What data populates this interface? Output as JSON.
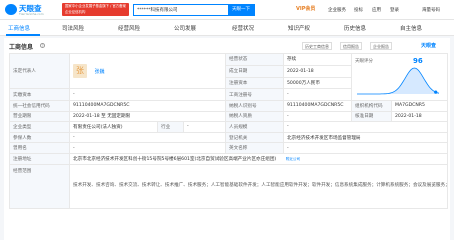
{
  "header": {
    "logo_text": "天眼查",
    "logo_subtext": "TianYanCha.com",
    "promo_text": "国家中小企业发展子基金旗下 / 官方备案企业征信机构",
    "search_value": "******科技有限公司",
    "search_button": "天眼一下",
    "vip_label": "VIP会员",
    "nav": [
      "企业服务",
      "投标",
      "应用",
      "登录"
    ],
    "phone_label": "海量号码"
  },
  "tabs": [
    {
      "label": "工商信息",
      "count": ""
    },
    {
      "label": "司法风险",
      "count": ""
    },
    {
      "label": "经营风险",
      "count": ""
    },
    {
      "label": "公司发展",
      "count": ""
    },
    {
      "label": "经营状况",
      "count": ""
    },
    {
      "label": "知识产权",
      "count": ""
    },
    {
      "label": "历史信息",
      "count": ""
    },
    {
      "label": "自主信息",
      "count": ""
    }
  ],
  "section": {
    "title": "工商信息",
    "actions": [
      "历史工商信息",
      "信用报告",
      "企业报告"
    ],
    "brand": "天眼查"
  },
  "info": {
    "legal_rep_label": "法定代表人",
    "legal_rep_avatar": "张",
    "legal_rep_name": "张巍",
    "status_label": "经营状态",
    "status_value": "存续",
    "founded_label": "成立日期",
    "founded_value": "2022-01-18",
    "score_label": "天眼评分",
    "score_value": "96",
    "reg_capital_label": "注册资本",
    "reg_capital_value": "50000万人民币",
    "paid_capital_label": "实缴资本",
    "paid_capital_value": "-",
    "reg_no_label": "工商注册号",
    "reg_no_value": "-",
    "credit_code_label": "统一社会信用代码",
    "credit_code_value": "91110400MA7GDCNR5C",
    "taxpayer_id_label": "纳税人识别号",
    "taxpayer_id_value": "91110400MA7GDCNR5C",
    "org_code_label": "组织机构代码",
    "org_code_value": "MA7GDCNR5",
    "term_label": "营业期限",
    "term_value": "2022-01-18 至 无固定期限",
    "taxpayer_qual_label": "纳税人资质",
    "taxpayer_qual_value": "-",
    "approve_label": "核准日期",
    "approve_value": "2022-01-18",
    "type_label": "企业类型",
    "type_value": "有限责任公司(法人独资)",
    "industry_label": "行业",
    "industry_value": "-",
    "staff_label": "人员规模",
    "staff_value": "-",
    "insured_label": "参保人数",
    "insured_value": "-",
    "authority_label": "登记机关",
    "authority_value": "北京经济技术开发区市场监督管理局",
    "former_name_label": "曾用名",
    "former_name_value": "-",
    "english_name_label": "英文名称",
    "english_name_value": "-",
    "address_label": "注册地址",
    "address_value": "北京市北京经济技术开发区科创十街15号院5号楼6层601室(北京自贸试验区高端产业片区亦庄组团)",
    "address_link": "附近公司",
    "copy_label": "复制",
    "scope_label": "经营范围",
    "scope_value": "技术开发、技术咨询、技术交流、技术转让、技术推广、技术服务；人工智能基础软件开发；人工智能应用软件开发；软件开发；信息系统集成服务；计算机系统服务；会议及展览服务；企业管理咨询；市场调查；组织文化艺术交流活动；数据处理服务；物联网技术服务……（市场主体依法自主选择经营项目，开展经营活动；依法须经批准的项目，经相关部门批准后依批准的内容开展经营活动；不得从事国家和本市产业政策禁止和限制类项目的经营活动。）"
  },
  "score_chart": {
    "type": "area",
    "value": 96,
    "series_color": "#0084ff"
  },
  "colors": {
    "accent": "#0084ff",
    "promo": "#e63b2e",
    "vip": "#e67e22"
  }
}
